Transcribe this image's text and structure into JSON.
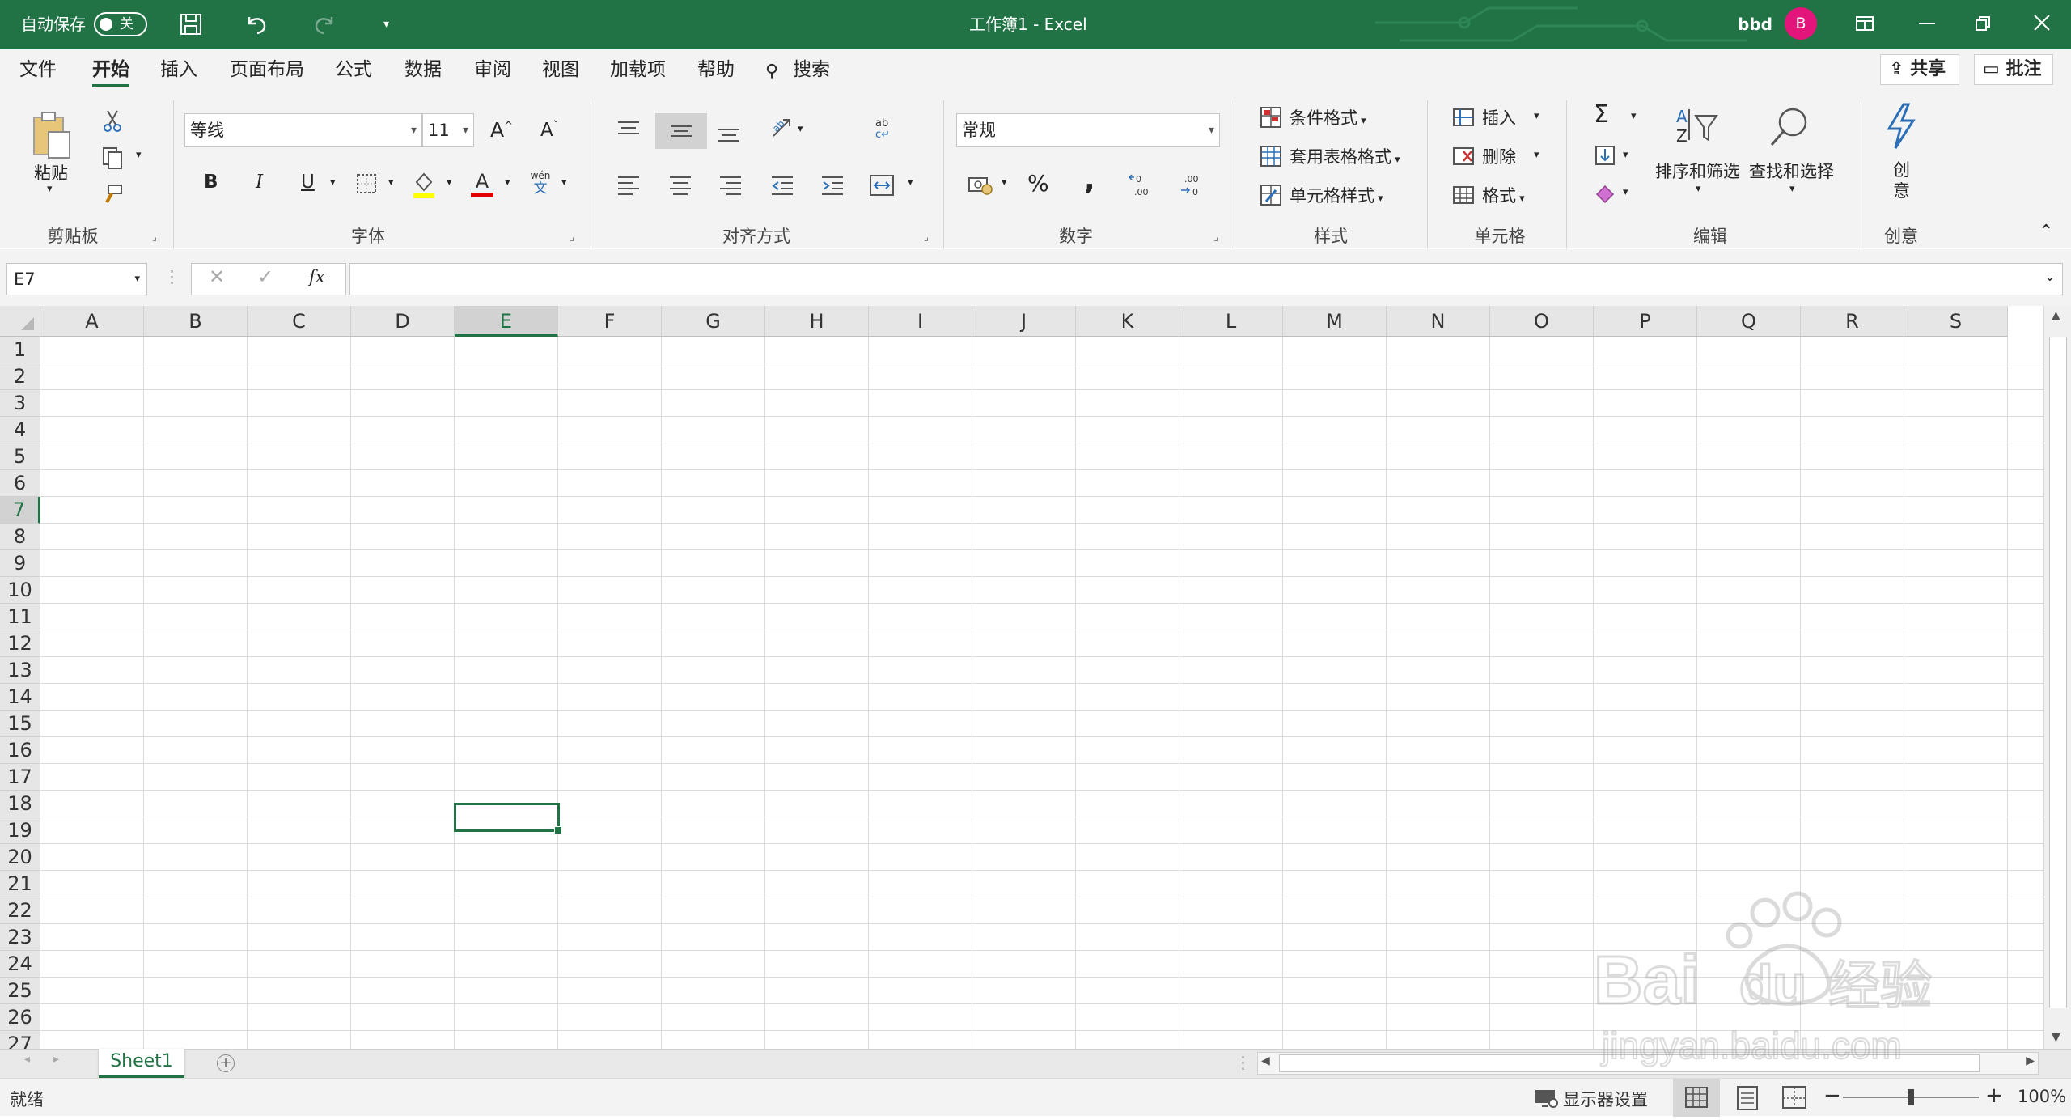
{
  "titlebar": {
    "autosave_label": "自动保存",
    "autosave_state": "关",
    "doc_title": "工作簿1  -  Excel",
    "user_name": "bbd",
    "user_initial": "B",
    "accent": "#217346",
    "avatar_color": "#e3157b"
  },
  "tabs": [
    "文件",
    "开始",
    "插入",
    "页面布局",
    "公式",
    "数据",
    "审阅",
    "视图",
    "加载项",
    "帮助",
    "搜索"
  ],
  "share_label": "共享",
  "comment_label": "批注",
  "ribbon": {
    "clipboard": {
      "paste": "粘贴",
      "label": "剪贴板"
    },
    "font": {
      "name": "等线",
      "size": "11",
      "bold": "B",
      "italic": "I",
      "underline": "U",
      "grow": "A",
      "shrink": "A",
      "font_color": "A",
      "phonetic": "wén",
      "label": "字体"
    },
    "alignment": {
      "label": "对齐方式"
    },
    "number": {
      "format": "常规",
      "percent": "%",
      "comma": ",",
      "label": "数字"
    },
    "styles": {
      "conditional": "条件格式",
      "table": "套用表格格式",
      "cell": "单元格样式",
      "label": "样式"
    },
    "cells": {
      "insert": "插入",
      "delete": "删除",
      "format": "格式",
      "label": "单元格"
    },
    "editing": {
      "sort": "排序和筛选",
      "find": "查找和选择",
      "label": "编辑"
    },
    "ideas": {
      "line1": "创",
      "line2": "意",
      "label": "创意"
    }
  },
  "formula_bar": {
    "name_box": "E7",
    "fx": "fx",
    "value": ""
  },
  "columns": [
    "A",
    "B",
    "C",
    "D",
    "E",
    "F",
    "G",
    "H",
    "I",
    "J",
    "K",
    "L",
    "M",
    "N",
    "O",
    "P",
    "Q",
    "R",
    "S"
  ],
  "rows": [
    "1",
    "2",
    "3",
    "4",
    "5",
    "6",
    "7",
    "8",
    "9",
    "10",
    "11",
    "12",
    "13",
    "14",
    "15",
    "16",
    "17",
    "18",
    "19",
    "20",
    "21",
    "22",
    "23",
    "24",
    "25",
    "26",
    "27"
  ],
  "sheets": [
    "Sheet1"
  ],
  "status": {
    "ready": "就绪",
    "display_settings": "显示器设置",
    "zoom": "100%",
    "zoom_level": 1.0
  },
  "watermark": {
    "brand": "Bai",
    "brand2": "du",
    "suffix": "经验",
    "url": "jingyan.baidu.com"
  }
}
